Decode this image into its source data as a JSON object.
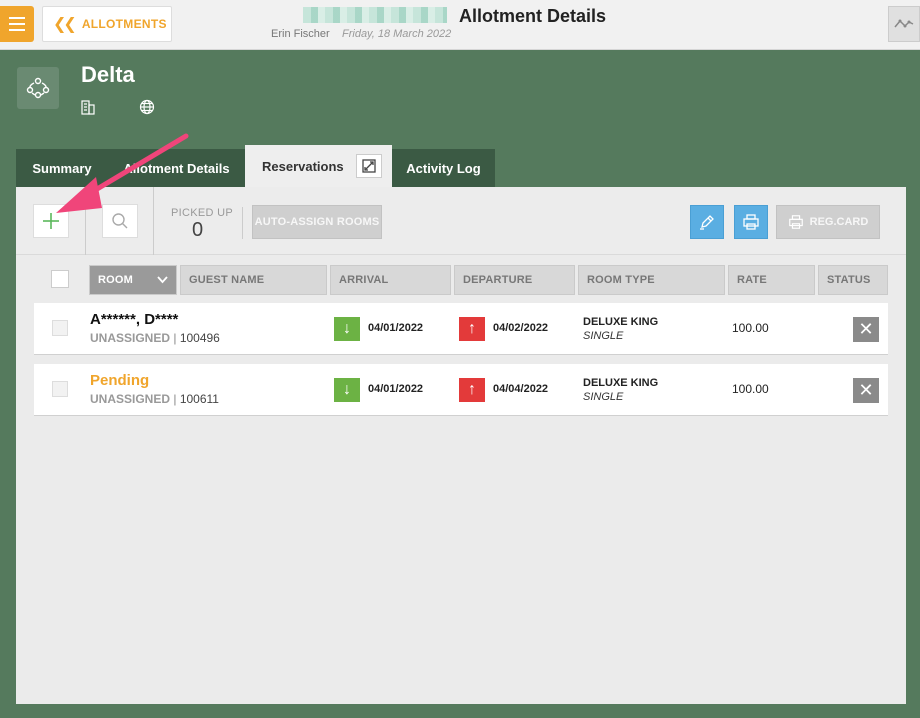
{
  "topbar": {
    "back_label": "ALLOTMENTS",
    "title": "Allotment Details",
    "user": "Erin Fischer",
    "date": "Friday, 18 March 2022"
  },
  "property": {
    "name": "Delta"
  },
  "tabs": [
    {
      "label": "Summary"
    },
    {
      "label": "Allotment Details"
    },
    {
      "label": "Reservations"
    },
    {
      "label": "Activity Log"
    }
  ],
  "toolbar": {
    "picked_up_label": "PICKED UP",
    "picked_up_value": "0",
    "auto_assign_label": "AUTO-ASSIGN ROOMS",
    "reg_card_label": "REG.CARD"
  },
  "table": {
    "headers": [
      "ROOM",
      "GUEST NAME",
      "ARRIVAL",
      "DEPARTURE",
      "ROOM TYPE",
      "RATE",
      "STATUS"
    ],
    "rows": [
      {
        "name": "A******, D****",
        "room": "UNASSIGNED",
        "number": "100496",
        "arrival": "04/01/2022",
        "departure": "04/02/2022",
        "room_type": "DELUXE KING",
        "occupancy": "SINGLE",
        "rate": "100.00"
      },
      {
        "name": "Pending",
        "room": "UNASSIGNED",
        "number": "100611",
        "arrival": "04/01/2022",
        "departure": "04/04/2022",
        "room_type": "DELUXE KING",
        "occupancy": "SINGLE",
        "rate": "100.00"
      }
    ]
  },
  "colors": {
    "accent": "#f0a52c",
    "background": "#557a5d",
    "tab_dark": "#3b5a44",
    "arrival_green": "#6cb244",
    "departure_red": "#e33a3a",
    "button_blue": "#5aaee2",
    "callout_pink": "#f0457a"
  },
  "icons": [
    "menu-icon",
    "chevron-left-icon",
    "activity-icon",
    "people-network-icon",
    "building-icon",
    "globe-icon",
    "expand-icon",
    "plus-icon",
    "search-icon",
    "pen-icon",
    "printer-icon",
    "arrow-down-icon",
    "arrow-up-icon",
    "close-icon"
  ]
}
